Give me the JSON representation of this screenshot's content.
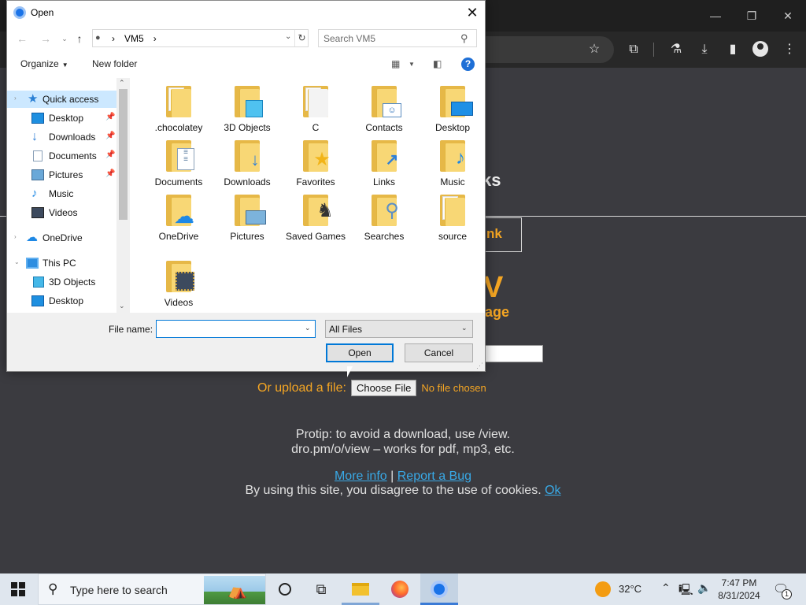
{
  "browser": {
    "window_controls": {
      "minimize": "—",
      "maximize": "❐",
      "close": "✕"
    },
    "toolbar_icons": [
      "star-icon",
      "extensions-icon",
      "labs-icon",
      "download-icon",
      "sidepanel-icon",
      "profile-icon",
      "menu-icon"
    ]
  },
  "webpage": {
    "heading_fragment": "ks",
    "link_fragment": "nk",
    "big_letter": "V",
    "sub_fragment": "age",
    "upload_label": "Or upload a file:",
    "choose_button": "Choose File",
    "no_file": "No file chosen",
    "protip_line1": "Protip: to avoid a download, use /view.",
    "protip_line2": "dro.pm/o/view – works for pdf, mp3, etc.",
    "more_info": "More info",
    "link_sep": "|",
    "report_bug": "Report a Bug",
    "cookie_text": "By using this site, you disagree to the use of cookies.",
    "cookie_ok": "Ok",
    "accent_color": "#f5a623",
    "link_color": "#39a9e6"
  },
  "dialog": {
    "title": "Open",
    "close_glyph": "✕",
    "nav": {
      "back": "←",
      "forward": "→",
      "up": "↑"
    },
    "address": {
      "pc_label": "VM5",
      "chevron": "›"
    },
    "search_placeholder": "Search VM5",
    "organize": "Organize",
    "new_folder": "New folder",
    "help": "?",
    "nav_pane": [
      {
        "label": "Quick access",
        "icon": "star-icon",
        "pinned": false,
        "selected": true
      },
      {
        "label": "Desktop",
        "icon": "desktop-icon",
        "pinned": true
      },
      {
        "label": "Downloads",
        "icon": "download-icon",
        "pinned": true
      },
      {
        "label": "Documents",
        "icon": "documents-icon",
        "pinned": true
      },
      {
        "label": "Pictures",
        "icon": "pictures-icon",
        "pinned": true
      },
      {
        "label": "Music",
        "icon": "music-icon",
        "pinned": false
      },
      {
        "label": "Videos",
        "icon": "videos-icon",
        "pinned": false
      },
      {
        "label": "OneDrive",
        "icon": "onedrive-icon",
        "pinned": false
      },
      {
        "label": "This PC",
        "icon": "this-pc-icon",
        "pinned": false
      },
      {
        "label": "3D Objects",
        "icon": "3d-objects-icon",
        "pinned": false
      },
      {
        "label": "Desktop",
        "icon": "desktop-icon",
        "pinned": false
      }
    ],
    "folders": [
      {
        "label": ".chocolatey",
        "icon": "folder-icon"
      },
      {
        "label": "3D Objects",
        "icon": "3d-objects-folder-icon"
      },
      {
        "label": "C",
        "icon": "folder-icon"
      },
      {
        "label": "Contacts",
        "icon": "contacts-folder-icon"
      },
      {
        "label": "Desktop",
        "icon": "desktop-folder-icon"
      },
      {
        "label": "Documents",
        "icon": "documents-folder-icon"
      },
      {
        "label": "Downloads",
        "icon": "downloads-folder-icon"
      },
      {
        "label": "Favorites",
        "icon": "favorites-folder-icon"
      },
      {
        "label": "Links",
        "icon": "links-folder-icon"
      },
      {
        "label": "Music",
        "icon": "music-folder-icon"
      },
      {
        "label": "OneDrive",
        "icon": "onedrive-folder-icon"
      },
      {
        "label": "Pictures",
        "icon": "pictures-folder-icon"
      },
      {
        "label": "Saved Games",
        "icon": "saved-games-folder-icon"
      },
      {
        "label": "Searches",
        "icon": "searches-folder-icon"
      },
      {
        "label": "source",
        "icon": "folder-icon"
      },
      {
        "label": "Videos",
        "icon": "videos-folder-icon"
      }
    ],
    "file_name_label": "File name:",
    "file_name_value": "",
    "file_type": "All Files",
    "open_button": "Open",
    "cancel_button": "Cancel"
  },
  "taskbar": {
    "search_text": "Type here to search",
    "weather": "32°C",
    "time": "7:47 PM",
    "date": "8/31/2024",
    "notification_count": "1"
  }
}
